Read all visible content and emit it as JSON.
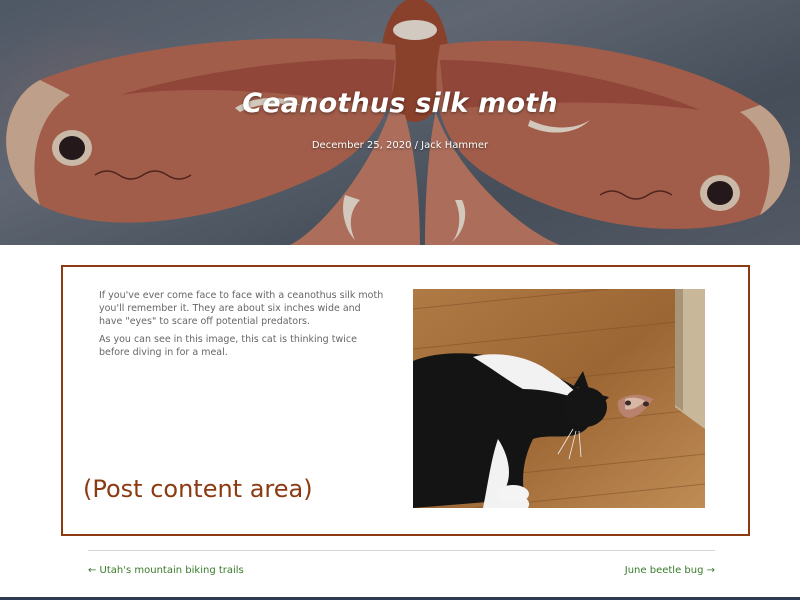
{
  "post": {
    "title": "Ceanothus silk moth",
    "date": "December 25, 2020",
    "separator": " / ",
    "author": "Jack Hammer",
    "paragraphs": [
      "If you've ever come face to face with a ceanothus silk moth you'll remember it. They are about six inches wide and have \"eyes\" to scare off potential predators.",
      "As you can see in this image, this cat is thinking twice before diving in for a meal."
    ],
    "area_label": "(Post content area)"
  },
  "navigation": {
    "previous": "← Utah's mountain biking trails",
    "next": "June beetle bug →"
  },
  "colors": {
    "accent_border": "#8b3a12",
    "link": "#3a7a2a",
    "hero_text": "#ffffff"
  }
}
